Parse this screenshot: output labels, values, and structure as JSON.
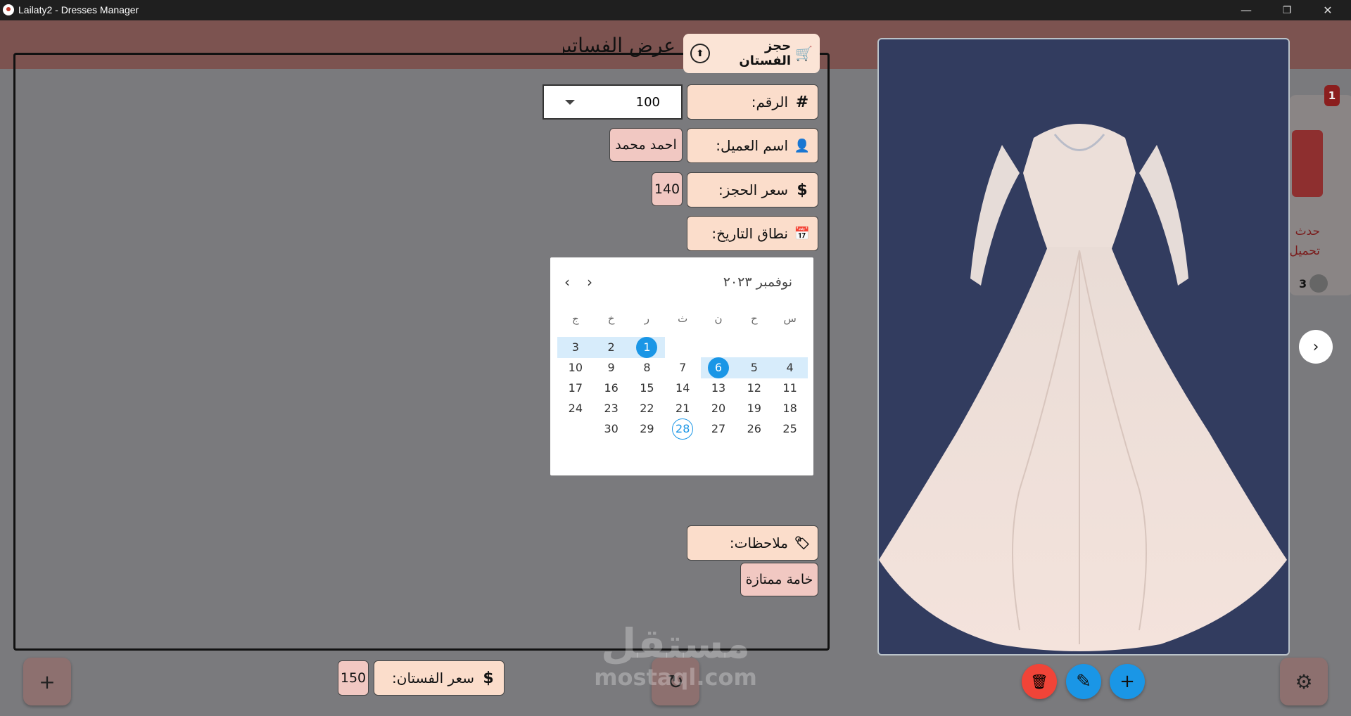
{
  "window": {
    "title": "Lailaty2 - Dresses Manager",
    "controls": {
      "minimize": "—",
      "restore": "❐",
      "close": "✕"
    }
  },
  "background_app": {
    "badge_count": "1",
    "card_text_line1": "حدث",
    "card_text_line2": "تحميل",
    "user_count": "3",
    "next_icon": "›"
  },
  "form": {
    "panel_title": "عرض الفساتين",
    "book_button": {
      "label": "حجز الفستان",
      "icon": "cart-icon",
      "icon_glyph": "🛒",
      "upload_glyph": "⬆"
    },
    "number": {
      "label": "الرقم:",
      "icon_glyph": "#",
      "selected": "100"
    },
    "customer": {
      "label": "اسم العميل:",
      "icon_glyph": "👤",
      "value": "احمد محمد"
    },
    "booking_price": {
      "label": "سعر الحجز:",
      "icon_glyph": "$",
      "value": "140"
    },
    "date_range": {
      "label": "نطاق التاريخ:",
      "icon_glyph": "📅"
    },
    "notes": {
      "label": "ملاحظات:",
      "icon_glyph": "🏷",
      "value": "خامة ممتازة"
    }
  },
  "calendar": {
    "month_label": "نوفمبر ٢٠٢٣",
    "prev_glyph": "‹",
    "next_glyph": "›",
    "weekdays": [
      "س",
      "ح",
      "ن",
      "ث",
      "ر",
      "خ",
      "ج"
    ],
    "weeks": [
      [
        "",
        "",
        "",
        "",
        "1",
        "2",
        "3"
      ],
      [
        "4",
        "5",
        "6",
        "7",
        "8",
        "9",
        "10"
      ],
      [
        "11",
        "12",
        "13",
        "14",
        "15",
        "16",
        "17"
      ],
      [
        "18",
        "19",
        "20",
        "21",
        "22",
        "23",
        "24"
      ],
      [
        "25",
        "26",
        "27",
        "28",
        "29",
        "30",
        ""
      ]
    ],
    "range_start": "1",
    "range_end": "6",
    "today": "28",
    "accent_color": "#1a96e6"
  },
  "bottom_bar": {
    "add_glyph": "+",
    "dress_price_label": "سعر الفستان:",
    "dress_price_icon": "$",
    "dress_price_value": "150",
    "refresh_glyph": "↻",
    "settings_glyph": "⚙",
    "delete_glyph": "🗑",
    "edit_glyph": "✎",
    "add_dress_glyph": "+"
  },
  "watermark": {
    "line1": "مستقل",
    "line2": "mostaql.com"
  },
  "colors": {
    "label_bg": "#fbddcb",
    "value_bg": "#f1c8c2",
    "delete": "#f04438",
    "edit": "#1a96e6",
    "add": "#1a96e6",
    "image_bg": "#323c5f"
  }
}
